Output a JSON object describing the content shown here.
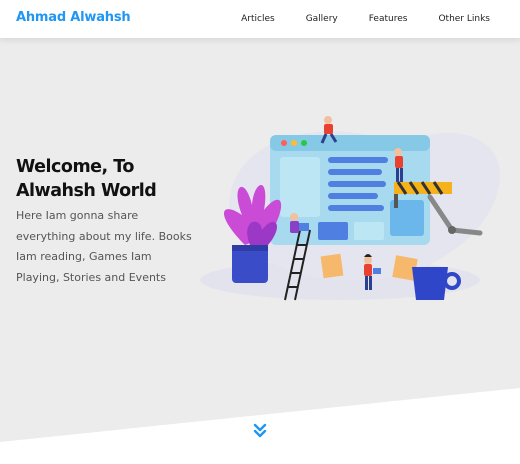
{
  "header": {
    "brand": "Ahmad Alwahsh",
    "nav": [
      {
        "label": "Articles"
      },
      {
        "label": "Gallery"
      },
      {
        "label": "Features"
      },
      {
        "label": "Other Links"
      }
    ]
  },
  "hero": {
    "title": "Welcome, To Alwahsh World",
    "text": "Here Iam gonna share everything about my life. Books Iam reading, Games Iam Playing, Stories and Events",
    "scroll_icon": "double-chevron-down-icon"
  },
  "colors": {
    "accent": "#2196f3",
    "hero_background": "#ececec",
    "text_dark": "#111111",
    "text_muted": "#555555"
  }
}
